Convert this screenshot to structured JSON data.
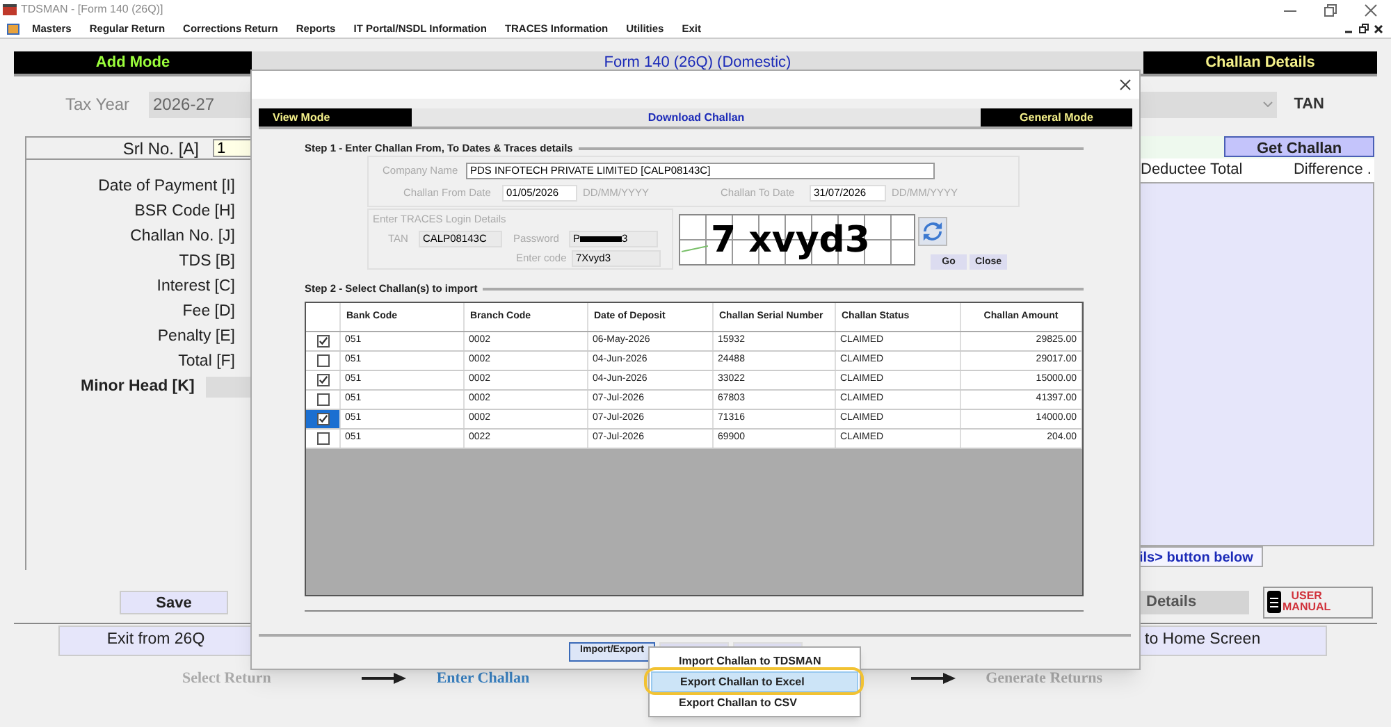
{
  "window": {
    "title": "TDSMAN - [Form 140 (26Q)]"
  },
  "menu": [
    "Masters",
    "Regular Return",
    "Corrections Return",
    "Reports",
    "IT Portal/NSDL Information",
    "TRACES Information",
    "Utilities",
    "Exit"
  ],
  "header": {
    "mode": "Add Mode",
    "title": "Form 140 (26Q) (Domestic)",
    "panel": "Challan Details"
  },
  "tax_year": {
    "label": "Tax Year",
    "value": "2026-27"
  },
  "tan_label": "TAN",
  "srl": {
    "label": "Srl No. [A]",
    "value": "1"
  },
  "fields": [
    "Date of Payment [I]",
    "BSR Code [H]",
    "Challan No. [J]",
    "TDS [B]",
    "Interest [C]",
    "Fee [D]",
    "Penalty [E]",
    "Total [F]"
  ],
  "minor_head": {
    "label": "Minor Head [K]"
  },
  "challan_panel": {
    "button": "Get Challan",
    "columns": [
      "Deductee Total",
      "Difference ."
    ],
    "hint": "ils> button below"
  },
  "buttons": {
    "save": "Save",
    "details": "Details",
    "manual": [
      "USER",
      "MANUAL"
    ],
    "exit": "Exit from 26Q",
    "home": "to Home Screen"
  },
  "steps": [
    {
      "label": "Select Return",
      "current": false
    },
    {
      "label": "Enter Challan",
      "current": true
    },
    {
      "label": "Generate Returns",
      "current": false
    }
  ],
  "dialog": {
    "modes": {
      "left": "View Mode",
      "title": "Download Challan",
      "right": "General Mode"
    },
    "step1": {
      "title": "Step 1 - Enter Challan From, To Dates & Traces details",
      "company_label": "Company Name",
      "company": "PDS INFOTECH PRIVATE LIMITED [CALP08143C]",
      "from_label": "Challan From Date",
      "from": "01/05/2026",
      "from_format": "DD/MM/YYYY",
      "to_label": "Challan To Date",
      "to": "31/07/2026",
      "to_format": "DD/MM/YYYY"
    },
    "login": {
      "title": "Enter TRACES Login Details",
      "tan_label": "TAN",
      "tan": "CALP08143C",
      "password_label": "Password",
      "password": {
        "start": "P",
        "end": "3"
      },
      "code_label": "Enter code",
      "code": "7Xvyd3",
      "captcha": "7 xvyd3",
      "go": "Go",
      "close": "Close"
    },
    "step2": {
      "title": "Step 2 - Select Challan(s) to import"
    },
    "table": {
      "columns": [
        "Bank Code",
        "Branch Code",
        "Date of Deposit",
        "Challan Serial Number",
        "Challan Status",
        "Challan Amount"
      ],
      "rows": [
        {
          "checked": true,
          "selected": false,
          "cells": [
            "051",
            "0002",
            "06-May-2026",
            "15932",
            "CLAIMED",
            "29825.00"
          ]
        },
        {
          "checked": false,
          "selected": false,
          "cells": [
            "051",
            "0002",
            "04-Jun-2026",
            "24488",
            "CLAIMED",
            "29017.00"
          ]
        },
        {
          "checked": true,
          "selected": false,
          "cells": [
            "051",
            "0002",
            "04-Jun-2026",
            "33022",
            "CLAIMED",
            "15000.00"
          ]
        },
        {
          "checked": false,
          "selected": false,
          "cells": [
            "051",
            "0002",
            "07-Jul-2026",
            "67803",
            "CLAIMED",
            "41397.00"
          ]
        },
        {
          "checked": true,
          "selected": true,
          "cells": [
            "051",
            "0002",
            "07-Jul-2026",
            "71316",
            "CLAIMED",
            "14000.00"
          ]
        },
        {
          "checked": false,
          "selected": false,
          "cells": [
            "051",
            "0022",
            "07-Jul-2026",
            "69900",
            "CLAIMED",
            "204.00"
          ]
        }
      ]
    },
    "buttons": [
      {
        "label": "Import/Export",
        "focused": true
      },
      {
        "focused": false
      },
      {
        "focused": false
      }
    ],
    "context_menu": [
      {
        "label": "Import Challan to TDSMAN",
        "selected": false,
        "circled": false
      },
      {
        "label": "Export Challan to Excel",
        "selected": true,
        "circled": true
      },
      {
        "label": "Export Challan to CSV",
        "selected": false,
        "circled": false
      }
    ]
  }
}
